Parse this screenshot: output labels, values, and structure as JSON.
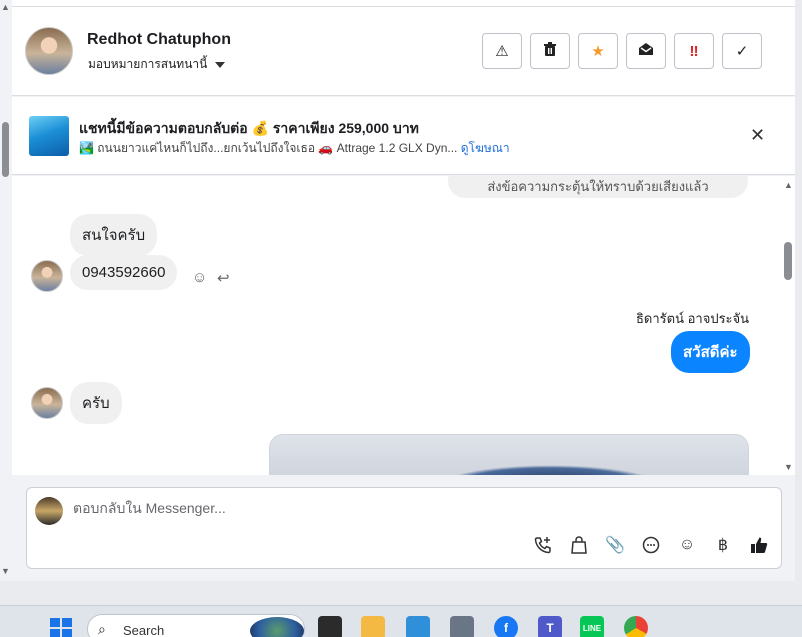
{
  "header": {
    "name": "Redhot Chatuphon",
    "assign_label": "มอบหมายการสนทนานี้",
    "actions": [
      {
        "icon": "warning-icon",
        "glyph": "⚠"
      },
      {
        "icon": "trash-icon",
        "glyph": "🗑"
      },
      {
        "icon": "star-icon",
        "glyph": "★"
      },
      {
        "icon": "mark-unread-icon",
        "glyph": "✉"
      },
      {
        "icon": "priority-icon",
        "glyph": "‼"
      },
      {
        "icon": "check-icon",
        "glyph": "✓"
      }
    ]
  },
  "ad": {
    "title": "แชทนี้มีข้อความตอบกลับต่อ 💰 ราคาเพียง 259,000 บาท",
    "subtitle": "🏞️ ถนนยาวแค่ไหนก็ไปถึง...ยกเว้นไปถึงใจเธอ 🚗 Attrage 1.2 GLX Dyn...",
    "link": "ดูโฆษณา"
  },
  "chat": {
    "system_text": "ส่งข้อความกระตุ้นให้ทราบด้วยเสียงแล้ว",
    "messages": [
      {
        "dir": "in",
        "text": "สนใจครับ"
      },
      {
        "dir": "in",
        "text": "0943592660"
      },
      {
        "dir": "out",
        "sender": "ธิดารัตน์ อาจประจัน",
        "text": "สวัสดีค่ะ"
      },
      {
        "dir": "in",
        "text": "ครับ"
      }
    ]
  },
  "reply": {
    "placeholder": "ตอบกลับใน Messenger..."
  },
  "taskbar": {
    "search_label": "Search"
  }
}
